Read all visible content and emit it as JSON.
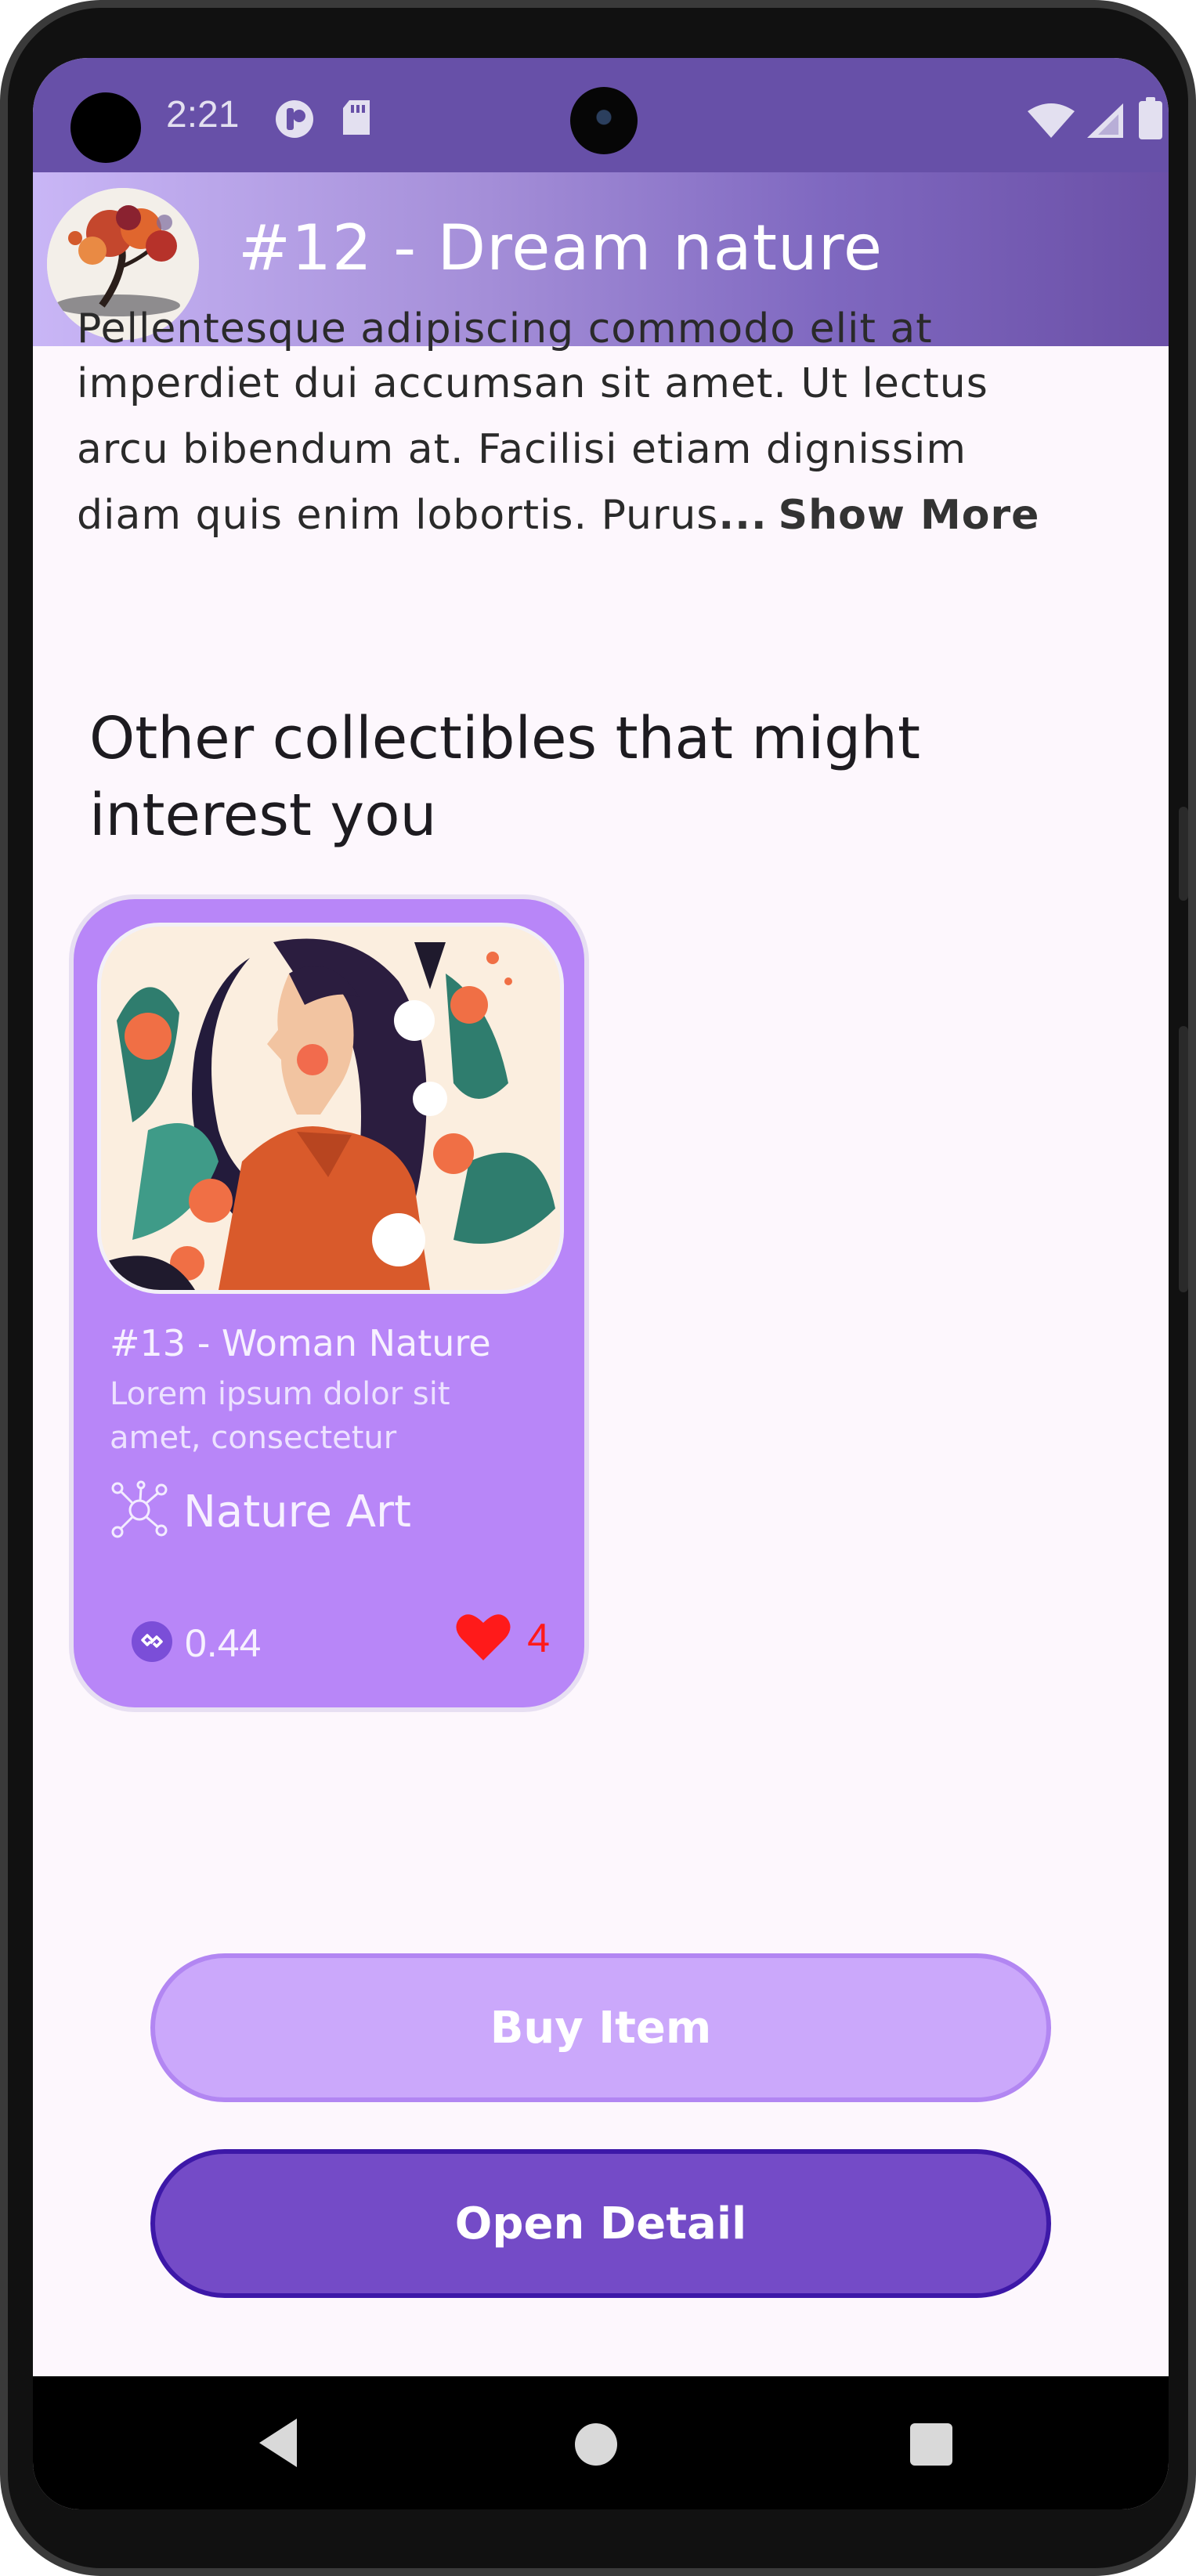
{
  "status_bar": {
    "time": "2:21"
  },
  "header": {
    "title": "#12 - Dream nature"
  },
  "description": {
    "cut_line": "Pellentesque adipiscing commodo elit at",
    "lines": [
      "imperdiet dui accumsan sit amet. Ut lectus",
      "arcu bibendum at. Facilisi etiam dignissim",
      "diam quis enim lobortis. Purus"
    ],
    "ellipsis": "...",
    "show_more": "Show More"
  },
  "recommendations": {
    "title": "Other collectibles that might interest you",
    "items": [
      {
        "title": "#13 - Woman Nature",
        "subtitle": "Lorem ipsum dolor sit amet, consectetur",
        "category": "Nature Art",
        "price": "0.44",
        "likes": "4"
      }
    ]
  },
  "actions": {
    "buy_label": "Buy Item",
    "detail_label": "Open Detail"
  },
  "colors": {
    "status_bar": "#6750a8",
    "card": "#b886f8",
    "buy_button": "#cba8fb",
    "open_button": "#744bc7",
    "like": "#ff1a1a"
  },
  "icons": {
    "status": [
      "app-icon",
      "sd-card-icon",
      "wifi-icon",
      "signal-icon",
      "battery-icon"
    ],
    "category": "network-nodes-icon",
    "price": "polygon-currency-icon",
    "likes": "heart-icon",
    "nav": [
      "back-icon",
      "home-icon",
      "recents-icon"
    ]
  }
}
